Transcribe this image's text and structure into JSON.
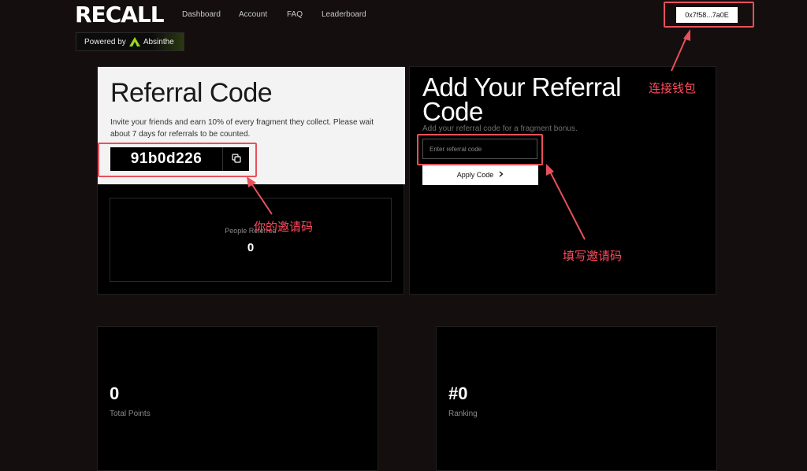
{
  "nav": {
    "logo": "RECALL",
    "links": [
      "Dashboard",
      "Account",
      "FAQ",
      "Leaderboard"
    ],
    "wallet": "0x7f58...7a0E",
    "powered_prefix": "Powered by",
    "powered_brand": "Absinthe"
  },
  "referral": {
    "title": "Referral Code",
    "description": "Invite your friends and earn 10% of every fragment they collect. Please wait about 7 days for referrals to be counted.",
    "code": "91b0d226",
    "copy_icon": "copy-icon",
    "people_label": "People Referred",
    "people_value": "0"
  },
  "add_referral": {
    "title": "Add Your Referral Code",
    "subtitle": "Add your referral code for a fragment bonus.",
    "input_placeholder": "Enter referral code",
    "input_value": "",
    "apply_label": "Apply Code",
    "apply_icon": "chevron-right-icon"
  },
  "stats": [
    {
      "value": "0",
      "label": "Total Points"
    },
    {
      "value": "#0",
      "label": "Ranking"
    }
  ],
  "annotations": {
    "wallet_note": "连接钱包",
    "code_note": "你的邀请码",
    "input_note": "填写邀请码"
  },
  "colors": {
    "background": "#140f0e",
    "card": "#000000",
    "light_panel": "#f3f3f3",
    "annotation": "#e8505b",
    "brand_green": "#9bd81f"
  }
}
